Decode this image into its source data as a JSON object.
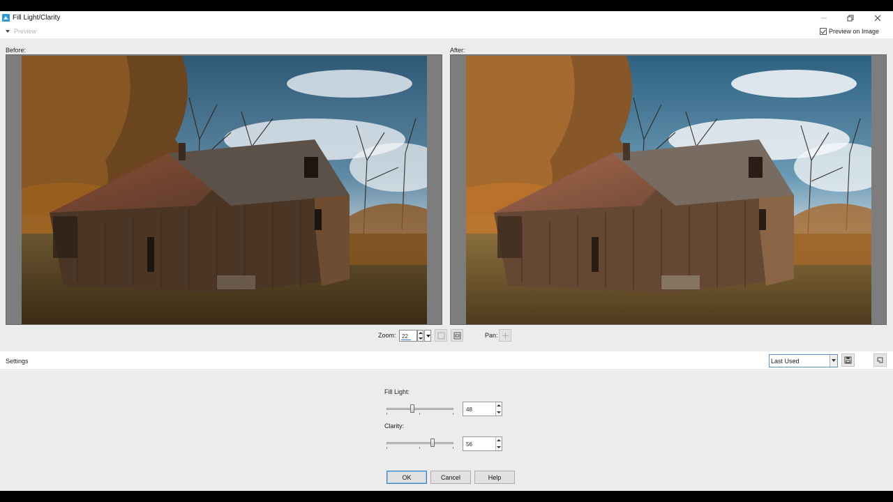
{
  "window": {
    "title": "Fill Light/Clarity",
    "controls": [
      "minimize",
      "restore",
      "close"
    ]
  },
  "preview_bar": {
    "preview_label": "Preview",
    "preview_on_image_label": "Preview on Image",
    "preview_on_image_checked": true
  },
  "panes": {
    "before_label": "Before:",
    "after_label": "After:"
  },
  "zoom": {
    "label": "Zoom:",
    "value": "22",
    "pan_label": "Pan:"
  },
  "settings": {
    "label": "Settings",
    "preset_value": "Last Used"
  },
  "fill_light": {
    "label": "Fill Light:",
    "value": "48"
  },
  "clarity": {
    "label": "Clarity:",
    "value": "56"
  },
  "buttons": {
    "ok": "OK",
    "cancel": "Cancel",
    "help": "Help"
  },
  "colors": {
    "dialog_bg": "#ececec",
    "accent": "#3c7fc2",
    "sky": "#3f6a86",
    "barn_wood": "#5a3f2b",
    "foliage": "#9a5a22"
  }
}
